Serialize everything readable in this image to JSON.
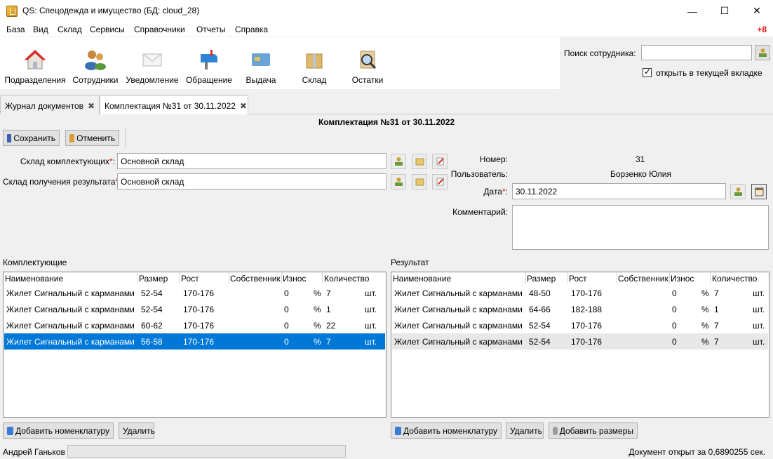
{
  "window": {
    "title": "QS: Спецодежда и имущество (БД: cloud_28)",
    "controls": {
      "minimize": "—",
      "maximize": "☐",
      "close": "✕"
    }
  },
  "menu": [
    "База",
    "Вид",
    "Склад",
    "Сервисы",
    "Справочники",
    "Отчеты",
    "Справка"
  ],
  "notification_badge": "+8",
  "toolbar": [
    {
      "label": "Подразделения",
      "icon": "house-icon"
    },
    {
      "label": "Сотрудники",
      "icon": "users-icon"
    },
    {
      "label": "Уведомление",
      "icon": "envelope-icon"
    },
    {
      "label": "Обращение",
      "icon": "mailbox-icon"
    },
    {
      "label": "Выдача",
      "icon": "card-icon"
    },
    {
      "label": "Склад",
      "icon": "box-icon"
    },
    {
      "label": "Остатки",
      "icon": "magnifier-icon"
    }
  ],
  "search": {
    "label": "Поиск сотрудника:",
    "value": "",
    "open_in_tab_label": "открыть в текущей вкладке",
    "open_in_tab_checked": true
  },
  "tabs": [
    {
      "label": "Журнал документов",
      "active": false
    },
    {
      "label": "Комплектация №31 от 30.11.2022",
      "active": true
    }
  ],
  "document": {
    "title": "Комплектация №31 от 30.11.2022",
    "save_label": "Сохранить",
    "cancel_label": "Отменить",
    "components_warehouse_label": "Склад комплектующих",
    "components_warehouse_value": "Основной склад",
    "result_warehouse_label": "Склад получения результата",
    "result_warehouse_value": "Основной склад",
    "number_label": "Номер:",
    "number_value": "31",
    "user_label": "Пользователь:",
    "user_value": "Борзенко Юлия",
    "date_label": "Дата",
    "date_value": "30.11.2022",
    "comment_label": "Комментарий:",
    "comment_value": ""
  },
  "components": {
    "label": "Комплектующие",
    "headers": [
      "Наименование",
      "Размер",
      "Рост",
      "Собственник",
      "Износ",
      "Количество"
    ],
    "rows": [
      {
        "name": "Жилет Сигнальный с карманами",
        "size": "52-54",
        "height": "170-176",
        "wear": "0",
        "pct": "%",
        "qty": "7",
        "unit": "шт."
      },
      {
        "name": "Жилет Сигнальный с карманами",
        "size": "52-54",
        "height": "170-176",
        "wear": "0",
        "pct": "%",
        "qty": "1",
        "unit": "шт."
      },
      {
        "name": "Жилет Сигнальный с карманами",
        "size": "60-62",
        "height": "170-176",
        "wear": "0",
        "pct": "%",
        "qty": "22",
        "unit": "шт."
      },
      {
        "name": "Жилет Сигнальный с карманами",
        "size": "56-58",
        "height": "170-176",
        "wear": "0",
        "pct": "%",
        "qty": "7",
        "unit": "шт."
      }
    ],
    "add_label": "Добавить номенклатуру",
    "delete_label": "Удалить"
  },
  "result": {
    "label": "Результат",
    "headers": [
      "Наименование",
      "Размер",
      "Рост",
      "Собственник",
      "Износ",
      "Количество"
    ],
    "rows": [
      {
        "name": "Жилет Сигнальный с карманами",
        "size": "48-50",
        "height": "170-176",
        "wear": "0",
        "pct": "%",
        "qty": "7",
        "unit": "шт."
      },
      {
        "name": "Жилет Сигнальный с карманами",
        "size": "64-66",
        "height": "182-188",
        "wear": "0",
        "pct": "%",
        "qty": "1",
        "unit": "шт."
      },
      {
        "name": "Жилет Сигнальный с карманами",
        "size": "52-54",
        "height": "170-176",
        "wear": "0",
        "pct": "%",
        "qty": "7",
        "unit": "шт."
      },
      {
        "name": "Жилет Сигнальный с карманами",
        "size": "52-54",
        "height": "170-176",
        "wear": "0",
        "pct": "%",
        "qty": "7",
        "unit": "шт."
      }
    ],
    "add_label": "Добавить номенклатуру",
    "delete_label": "Удалить",
    "add_sizes_label": "Добавить размеры"
  },
  "status": {
    "user": "Андрей Ганьков",
    "message": "Документ открыт за 0,6890255 сек."
  },
  "colors": {
    "selection": "#0078d7",
    "required": "#e01010",
    "badge": "#e01010"
  }
}
